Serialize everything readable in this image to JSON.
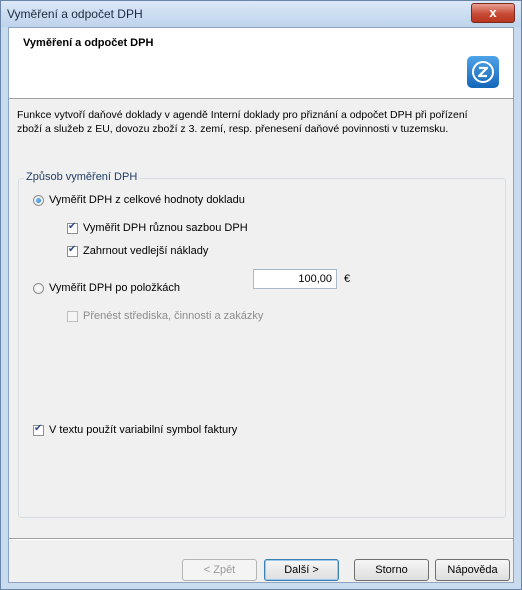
{
  "window": {
    "title": "Vyměření a odpočet DPH",
    "close_label": "x"
  },
  "header": {
    "title": "Vyměření a odpočet DPH"
  },
  "description": [
    "Funkce vytvoří daňové doklady v agendě Interní doklady pro přiznání a odpočet DPH při pořízení",
    "zboží a služeb z EU, dovozu zboží z 3. zemí, resp. přenesení daňové povinnosti v tuzemsku."
  ],
  "group": {
    "legend": "Způsob vyměření DPH",
    "radio_total": "Vyměřit DPH z celkové hodnoty dokladu",
    "check_rates": "Vyměřit DPH různou sazbou DPH",
    "check_costs": "Zahrnout vedlejší náklady",
    "costs_value": "100,00",
    "currency": "€",
    "radio_items": "Vyměřit DPH po položkách",
    "check_transfer": "Přenést střediska, činnosti a zakázky",
    "check_varsym": "V textu použít variabilní symbol faktury"
  },
  "state": {
    "radio_total": true,
    "check_rates": true,
    "check_costs": true,
    "radio_items": false,
    "check_transfer": false,
    "check_varsym": true
  },
  "buttons": {
    "back": "< Zpět",
    "next": "Další >",
    "cancel": "Storno",
    "help": "Nápověda"
  }
}
